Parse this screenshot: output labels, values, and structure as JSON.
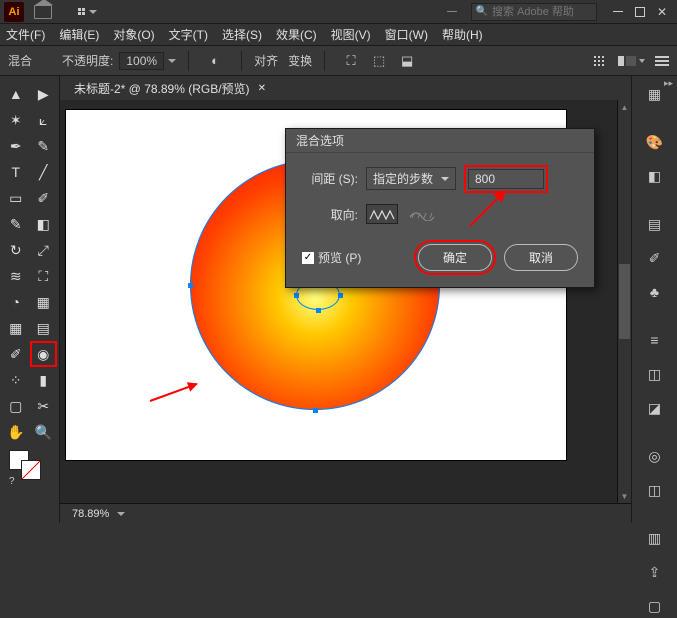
{
  "app": {
    "logo_text": "Ai"
  },
  "search": {
    "placeholder": "搜索 Adobe 帮助"
  },
  "menu": {
    "file": "文件(F)",
    "edit": "编辑(E)",
    "object": "对象(O)",
    "type": "文字(T)",
    "select": "选择(S)",
    "effect": "效果(C)",
    "view": "视图(V)",
    "window": "窗口(W)",
    "help": "帮助(H)"
  },
  "ctrl": {
    "blend": "混合",
    "opacity_label": "不透明度:",
    "opacity_value": "100%",
    "align": "对齐",
    "transform": "变换"
  },
  "doc": {
    "tab_title": "未标题-2* @ 78.89% (RGB/预览)",
    "zoom": "78.89%"
  },
  "dialog": {
    "title": "混合选项",
    "spacing_label": "间距 (S):",
    "spacing_mode": "指定的步数",
    "spacing_value": "800",
    "orient_label": "取向:",
    "preview_label": "预览 (P)",
    "ok": "确定",
    "cancel": "取消"
  }
}
